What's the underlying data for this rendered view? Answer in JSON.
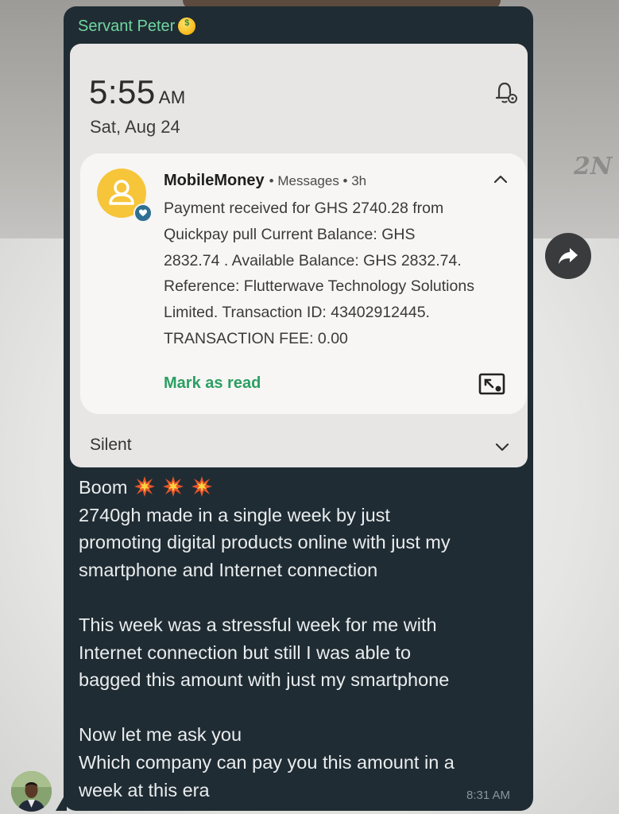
{
  "sender": {
    "name": "Servant Peter",
    "emoji": "money-mouth-face-icon"
  },
  "screenshot": {
    "time": "5:55",
    "ampm": "AM",
    "date": "Sat, Aug 24",
    "notification": {
      "app": "MobileMoney",
      "meta": "• Messages • 3h",
      "body": "Payment received for GHS 2740.28 from\nQuickpay pull  Current Balance: GHS\n2832.74 . Available Balance: GHS 2832.74.\nReference: Flutterwave Technology Solutions\nLimited. Transaction ID: 43402912445.\nTRANSACTION FEE: 0.00",
      "action": "Mark as read"
    },
    "section_label": "Silent"
  },
  "message": {
    "first_line": "Boom",
    "text": "2740gh made in a single week by just\npromoting digital products online with just my\nsmartphone and Internet connection\n\nThis week was a stressful week for me with\nInternet connection but still I was able to\nbagged this amount with just my smartphone\n\nNow let me ask you\nWhich company can pay you this amount in a\nweek at this era",
    "time": "8:31 AM"
  },
  "watermark": "2N",
  "colors": {
    "bubble": "#202c33",
    "sender_name": "#6fd6a1",
    "mark_read": "#2c9f63",
    "avatar_ring": "#f6c53a"
  }
}
